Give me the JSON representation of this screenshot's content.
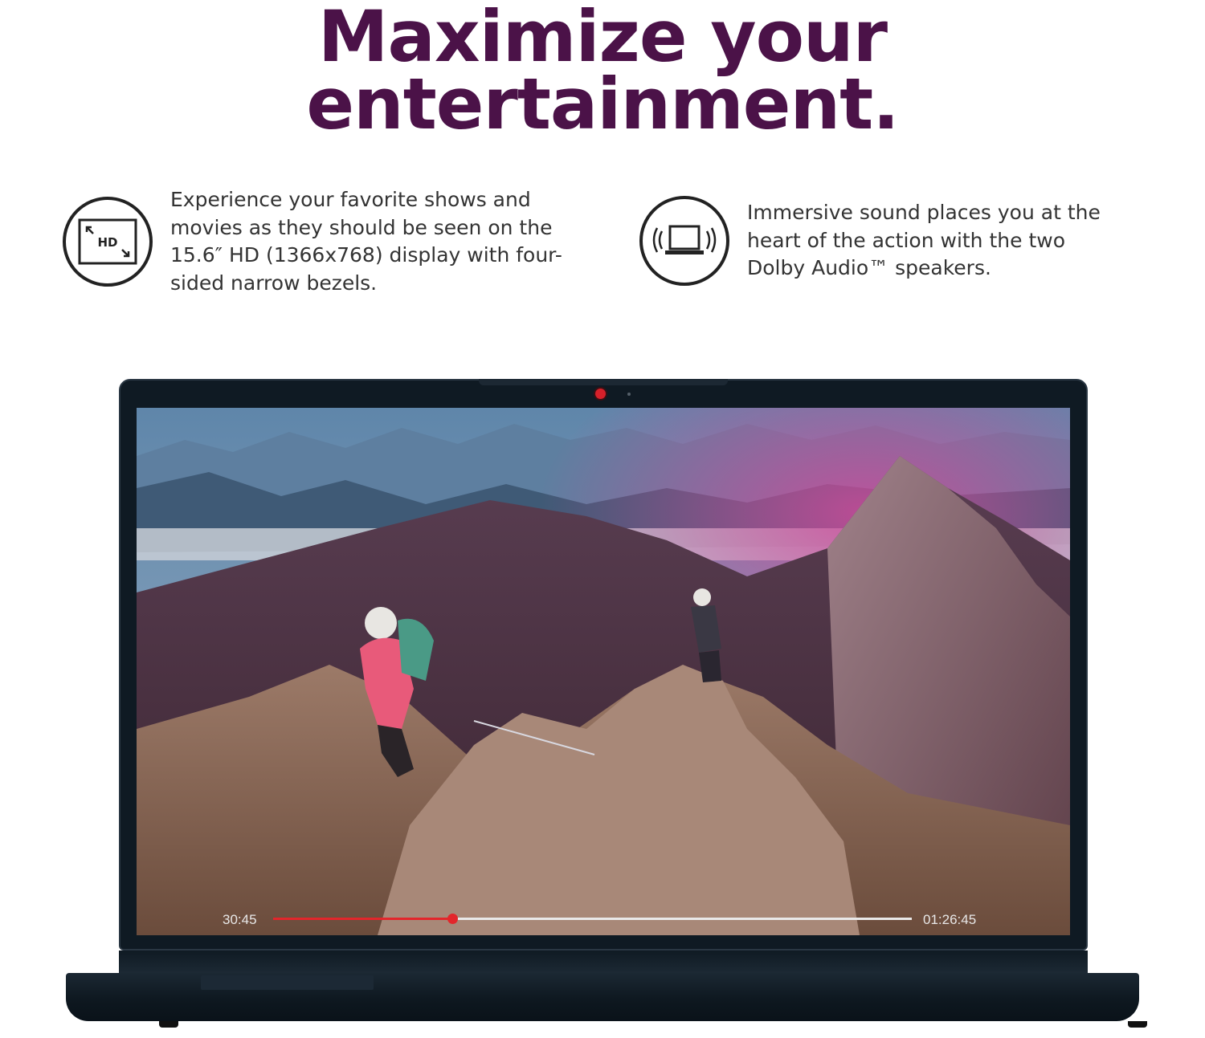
{
  "headline": {
    "line1": "Maximize your",
    "line2": "entertainment."
  },
  "features": [
    {
      "icon": "hd-display-icon",
      "icon_label": "HD",
      "text": "Experience your favorite shows and movies as they should be seen on the 15.6″ HD (1366x768) display with four-sided narrow bezels."
    },
    {
      "icon": "laptop-speaker-icon",
      "text": "Immersive sound places you at the heart of the action with the two Dolby Audio™ speakers."
    }
  ],
  "video_player": {
    "elapsed": "30:45",
    "total": "01:26:45",
    "progress": 0.28
  },
  "colors": {
    "headline": "#4b1248",
    "body_text": "#333333",
    "laptop": "#0f1a23",
    "seek_progress": "#e3262b",
    "seek_track": "#e9e9e9"
  }
}
